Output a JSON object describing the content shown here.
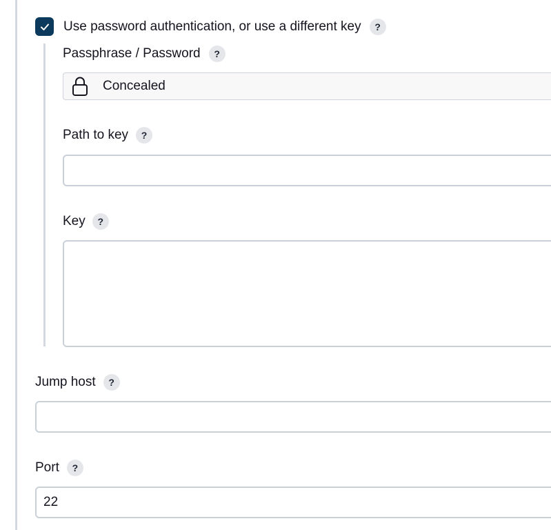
{
  "auth": {
    "checkbox_label": "Use password authentication, or use a different key",
    "checked": true,
    "help": "?"
  },
  "passphrase": {
    "label": "Passphrase / Password",
    "help": "?",
    "value": "Concealed",
    "icon": "lock-icon"
  },
  "path_to_key": {
    "label": "Path to key",
    "help": "?",
    "value": ""
  },
  "key": {
    "label": "Key",
    "help": "?",
    "value": ""
  },
  "jump_host": {
    "label": "Jump host",
    "help": "?",
    "value": ""
  },
  "port": {
    "label": "Port",
    "help": "?",
    "value": "22"
  },
  "colors": {
    "accent": "#0b3a5c",
    "border": "#c9d0d8",
    "rule": "#d4d9e1"
  }
}
